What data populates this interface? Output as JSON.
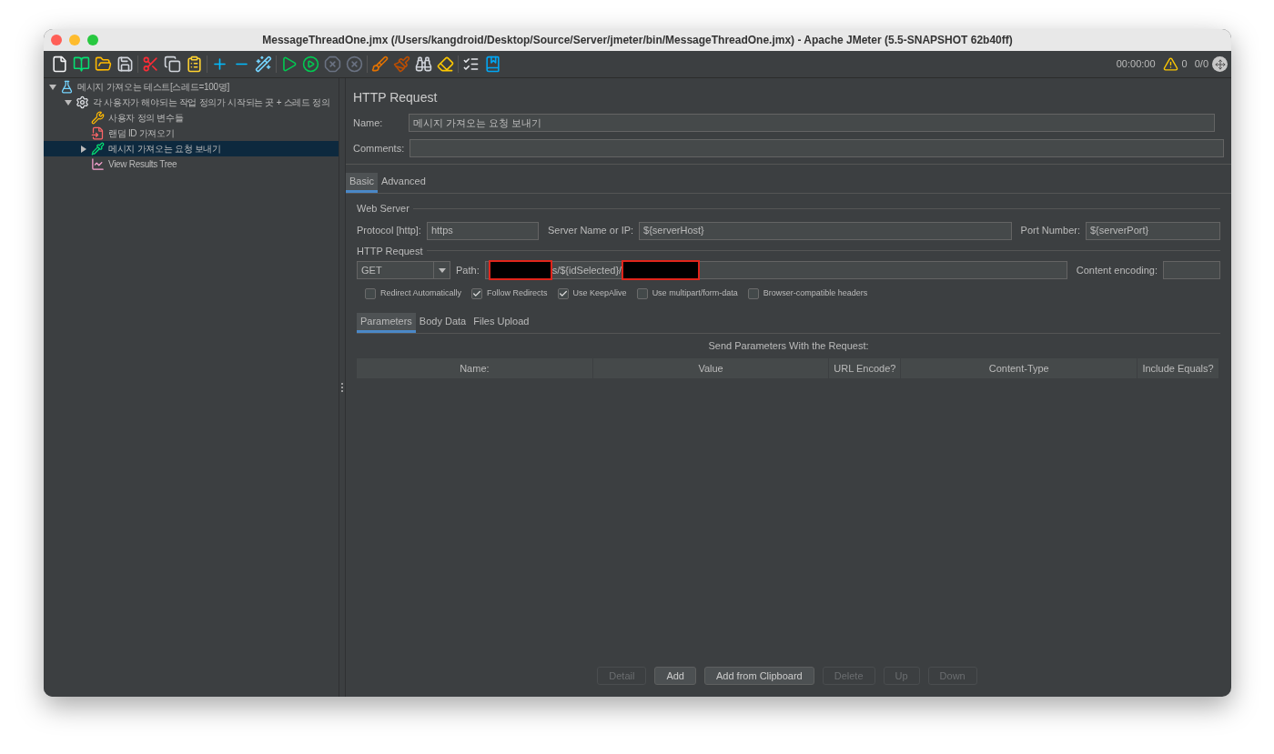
{
  "window": {
    "title": "MessageThreadOne.jmx (/Users/kangdroid/Desktop/Source/Server/jmeter/bin/MessageThreadOne.jmx) - Apache JMeter (5.5-SNAPSHOT 62b40ff)"
  },
  "status": {
    "elapsed": "00:00:00",
    "warnings": "0",
    "threads": "0/0"
  },
  "tree": [
    {
      "label": "메시지 가져오는 테스트[스레드=100명]",
      "kind": "test_plan",
      "expanded": true,
      "selected": false,
      "children": [
        {
          "label": "각 사용자가 해야되는 작업 정의가 시작되는 곳 + 스레드 정의",
          "kind": "thread_group",
          "expanded": true,
          "selected": false,
          "children": [
            {
              "label": "사용자 정의 변수들",
              "kind": "config",
              "selected": false
            },
            {
              "label": "랜덤 ID 가져오기",
              "kind": "preprocessor",
              "selected": false
            },
            {
              "label": "메시지 가져오는 요청 보내기",
              "kind": "sampler",
              "expanded": false,
              "selected": true
            },
            {
              "label": "View Results Tree",
              "kind": "listener",
              "selected": false
            }
          ]
        }
      ]
    }
  ],
  "editor": {
    "title": "HTTP Request",
    "name": {
      "label": "Name:",
      "value": "메시지 가져오는 요청 보내기"
    },
    "comments": {
      "label": "Comments:"
    },
    "tabs": [
      {
        "label": "Basic",
        "selected": true
      },
      {
        "label": "Advanced",
        "selected": false
      }
    ],
    "web_server": {
      "legend": "Web Server",
      "protocol": {
        "label": "Protocol [http]:",
        "value": "https"
      },
      "server": {
        "label": "Server Name or IP:",
        "value": "${serverHost}"
      },
      "port": {
        "label": "Port Number:",
        "value": "${serverPort}"
      }
    },
    "http_request": {
      "legend": "HTTP Request",
      "method": "GET",
      "path": {
        "label": "Path:",
        "value": "s/${idSelected}/"
      },
      "encoding": {
        "label": "Content encoding:"
      },
      "options": [
        {
          "label": "Redirect Automatically",
          "checked": false
        },
        {
          "label": "Follow Redirects",
          "checked": true
        },
        {
          "label": "Use KeepAlive",
          "checked": true
        },
        {
          "label": "Use multipart/form-data",
          "checked": false
        },
        {
          "label": "Browser-compatible headers",
          "checked": false
        }
      ]
    },
    "param_tabs": [
      {
        "label": "Parameters",
        "selected": true
      },
      {
        "label": "Body Data",
        "selected": false
      },
      {
        "label": "Files Upload",
        "selected": false
      }
    ],
    "params_title": "Send Parameters With the Request:",
    "columns": [
      "Name:",
      "Value",
      "URL Encode?",
      "Content-Type",
      "Include Equals?"
    ],
    "buttons": [
      {
        "label": "Detail",
        "disabled": true
      },
      {
        "label": "Add",
        "disabled": false
      },
      {
        "label": "Add from Clipboard",
        "disabled": false
      },
      {
        "label": "Delete",
        "disabled": true
      },
      {
        "label": "Up",
        "disabled": true
      },
      {
        "label": "Down",
        "disabled": true
      }
    ]
  }
}
